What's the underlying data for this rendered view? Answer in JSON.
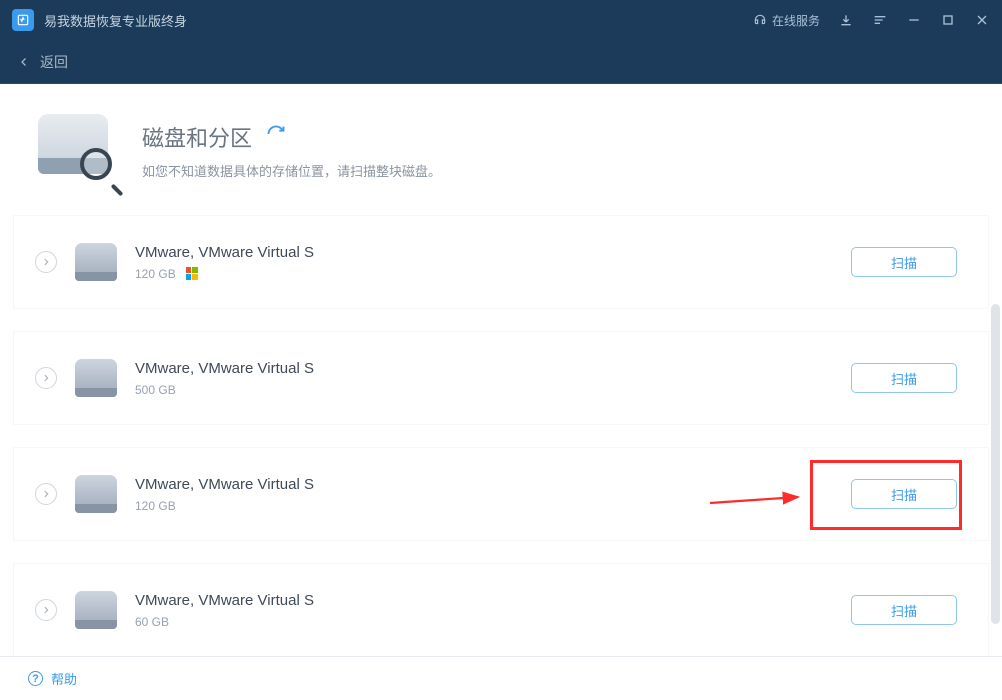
{
  "app": {
    "title": "易我数据恢复专业版终身",
    "support_label": "在线服务"
  },
  "nav": {
    "back_label": "返回"
  },
  "header": {
    "title": "磁盘和分区",
    "subtitle": "如您不知道数据具体的存储位置，请扫描整块磁盘。"
  },
  "scan_label": "扫描",
  "disks": [
    {
      "name": "VMware,  VMware Virtual S",
      "size": "120 GB",
      "has_windows": true
    },
    {
      "name": "VMware,  VMware Virtual S",
      "size": "500 GB",
      "has_windows": false
    },
    {
      "name": "VMware,  VMware Virtual S",
      "size": "120 GB",
      "has_windows": false
    },
    {
      "name": "VMware,  VMware Virtual S",
      "size": "60 GB",
      "has_windows": false
    }
  ],
  "footer": {
    "help_label": "帮助"
  },
  "colors": {
    "accent": "#3a9bed",
    "titlebar": "#1c3b5a",
    "annotation": "#ff2a2a"
  }
}
